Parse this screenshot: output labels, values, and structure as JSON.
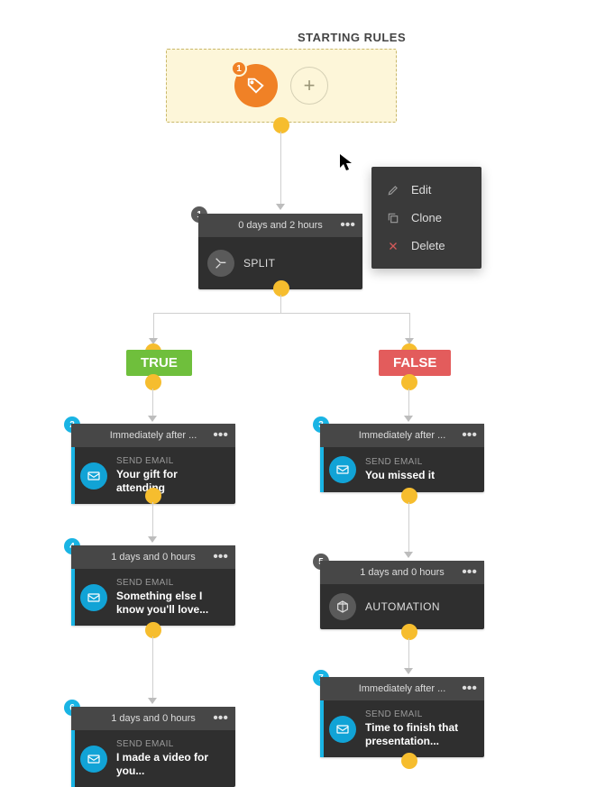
{
  "start": {
    "label": "STARTING RULES",
    "tag_badge": "1"
  },
  "context_menu": {
    "edit": "Edit",
    "clone": "Clone",
    "delete": "Delete"
  },
  "branches": {
    "true_label": "TRUE",
    "false_label": "FALSE"
  },
  "nodes": {
    "split": {
      "num": "1",
      "header": "0 days and 2 hours",
      "label": "SPLIT"
    },
    "n2": {
      "num": "2",
      "header": "Immediately after ...",
      "type": "SEND EMAIL",
      "title": "Your gift for attending"
    },
    "n3": {
      "num": "3",
      "header": "Immediately after ...",
      "type": "SEND EMAIL",
      "title": "You missed it"
    },
    "n4": {
      "num": "4",
      "header": "1 days and 0 hours",
      "type": "SEND EMAIL",
      "title": "Something else I know you'll love..."
    },
    "n5": {
      "num": "5",
      "header": "1 days and 0 hours",
      "type": "AUTOMATION",
      "title": ""
    },
    "n6": {
      "num": "6",
      "header": "1 days and 0 hours",
      "type": "SEND EMAIL",
      "title": "I made a video for you..."
    },
    "n7": {
      "num": "7",
      "header": "Immediately after ...",
      "type": "SEND EMAIL",
      "title": "Time to finish that presentation..."
    }
  }
}
